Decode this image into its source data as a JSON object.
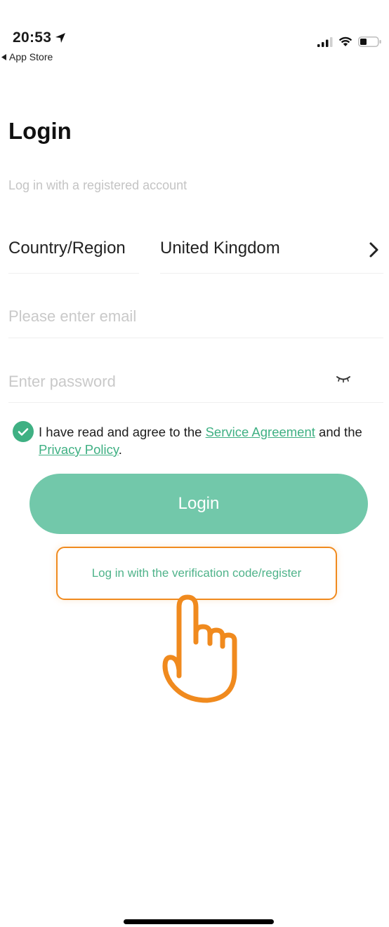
{
  "status_bar": {
    "time": "20:53",
    "back_app": "App Store",
    "icons": [
      "location-arrow-icon",
      "signal-icon",
      "wifi-icon",
      "battery-icon"
    ]
  },
  "page": {
    "title": "Login",
    "subtitle": "Log in with a registered account"
  },
  "country": {
    "label": "Country/Region",
    "value": "United Kingdom"
  },
  "email": {
    "placeholder": "Please enter email",
    "value": ""
  },
  "password": {
    "placeholder": "Enter password",
    "value": ""
  },
  "agreement": {
    "checked": true,
    "text_before": "I have read and agree to the ",
    "service_link": "Service Agreement",
    "text_middle": " and the ",
    "privacy_link": "Privacy Policy",
    "text_after": "."
  },
  "login_button": {
    "label": "Login"
  },
  "verification_link": {
    "label": "Log in with the verification code/register"
  },
  "colors": {
    "accent": "#3fb083",
    "button": "#72c8aa",
    "highlight": "#f08a1e"
  }
}
